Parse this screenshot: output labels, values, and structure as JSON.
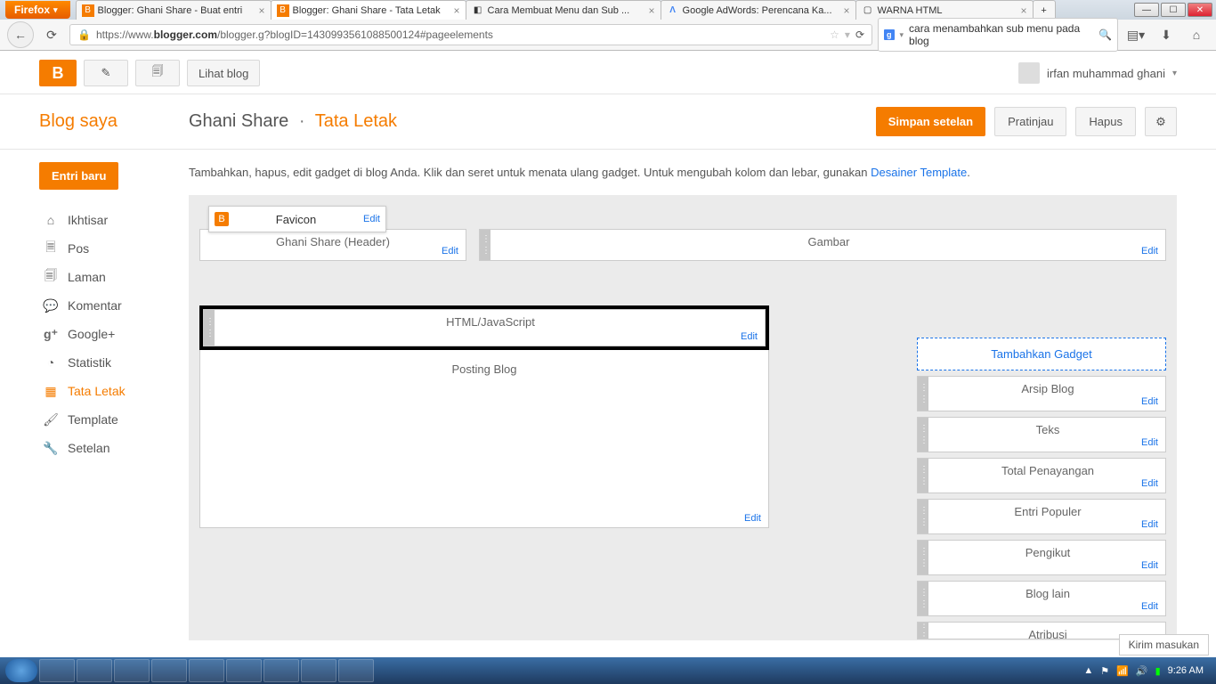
{
  "browser": {
    "firefox_label": "Firefox",
    "tabs": [
      {
        "title": "Blogger: Ghani Share - Buat entri",
        "icon": "B"
      },
      {
        "title": "Blogger: Ghani Share - Tata Letak",
        "icon": "B",
        "active": true
      },
      {
        "title": "Cara Membuat Menu dan Sub ...",
        "icon": "◧"
      },
      {
        "title": "Google AdWords: Perencana Ka...",
        "icon": "A"
      },
      {
        "title": "WARNA HTML",
        "icon": "▢"
      }
    ],
    "url_prefix": "https://www.",
    "url_host": "blogger.com",
    "url_path": "/blogger.g?blogID=143099356108850​0124#pageelements",
    "search_value": "cara menambahkan sub menu pada blog"
  },
  "toolbar": {
    "view_blog": "Lihat blog",
    "user_name": "irfan muhammad ghani"
  },
  "header": {
    "my_blogs": "Blog saya",
    "blog_name": "Ghani Share",
    "page_name": "Tata Letak",
    "save": "Simpan setelan",
    "preview": "Pratinjau",
    "delete": "Hapus"
  },
  "sidebar": {
    "new_entry": "Entri baru",
    "items": [
      {
        "label": "Ikhtisar",
        "icon": "⌂"
      },
      {
        "label": "Pos",
        "icon": "📄"
      },
      {
        "label": "Laman",
        "icon": "🗐"
      },
      {
        "label": "Komentar",
        "icon": "💬"
      },
      {
        "label": "Google+",
        "icon": "g⁺"
      },
      {
        "label": "Statistik",
        "icon": "◔"
      },
      {
        "label": "Tata Letak",
        "icon": "▦",
        "active": true
      },
      {
        "label": "Template",
        "icon": "🖌"
      },
      {
        "label": "Setelan",
        "icon": "🔧"
      }
    ]
  },
  "content": {
    "hint_text": "Tambahkan, hapus, edit gadget di blog Anda. Klik dan seret untuk menata ulang gadget. Untuk mengubah kolom dan lebar, gunakan ",
    "hint_link": "Desainer Template",
    "edit_label": "Edit",
    "gadgets": {
      "favicon": "Favicon",
      "header": "Ghani Share (Header)",
      "gambar": "Gambar",
      "htmljs": "HTML/JavaScript",
      "posting": "Posting Blog",
      "add_gadget": "Tambahkan Gadget",
      "side": [
        "Arsip Blog",
        "Teks",
        "Total Penayangan",
        "Entri Populer",
        "Pengikut",
        "Blog lain",
        "Atribusi"
      ]
    }
  },
  "footer": {
    "feedback": "Kirim masukan",
    "time": "9:26 AM"
  }
}
